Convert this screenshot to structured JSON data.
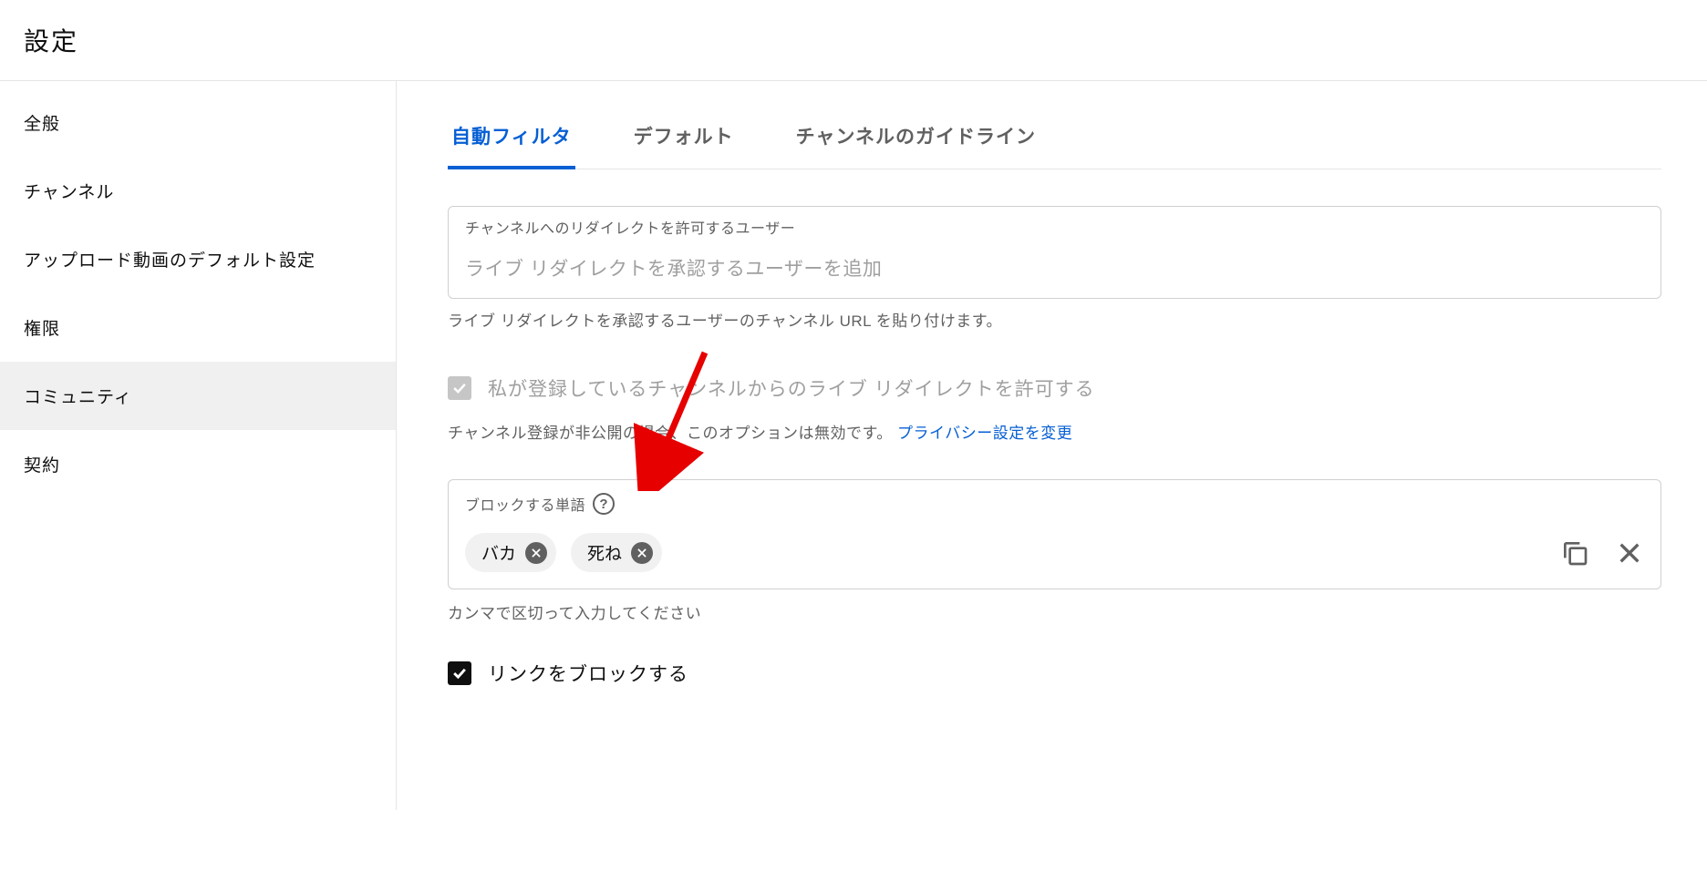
{
  "page_title": "設定",
  "sidebar": {
    "items": [
      {
        "label": "全般",
        "active": false
      },
      {
        "label": "チャンネル",
        "active": false
      },
      {
        "label": "アップロード動画のデフォルト設定",
        "active": false
      },
      {
        "label": "権限",
        "active": false
      },
      {
        "label": "コミュニティ",
        "active": true
      },
      {
        "label": "契約",
        "active": false
      }
    ]
  },
  "tabs": [
    {
      "label": "自動フィルタ",
      "active": true
    },
    {
      "label": "デフォルト",
      "active": false
    },
    {
      "label": "チャンネルのガイドライン",
      "active": false
    }
  ],
  "redirect_field": {
    "label": "チャンネルへのリダイレクトを許可するユーザー",
    "placeholder": "ライブ リダイレクトを承認するユーザーを追加",
    "help": "ライブ リダイレクトを承認するユーザーのチャンネル URL を貼り付けます。"
  },
  "allow_redirect_checkbox": {
    "label": "私が登録しているチャンネルからのライブ リダイレクトを許可する",
    "checked": true,
    "disabled": true,
    "help_prefix": "チャンネル登録が非公開の場合、このオプションは無効です。",
    "help_link": "プライバシー設定を変更"
  },
  "blocked_words": {
    "label": "ブロックする単語",
    "chips": [
      "バカ",
      "死ね"
    ],
    "help": "カンマで区切って入力してください"
  },
  "block_links": {
    "label": "リンクをブロックする",
    "checked": true
  },
  "annotation": {
    "type": "red-arrow",
    "points_to": "blocked-words-field"
  }
}
